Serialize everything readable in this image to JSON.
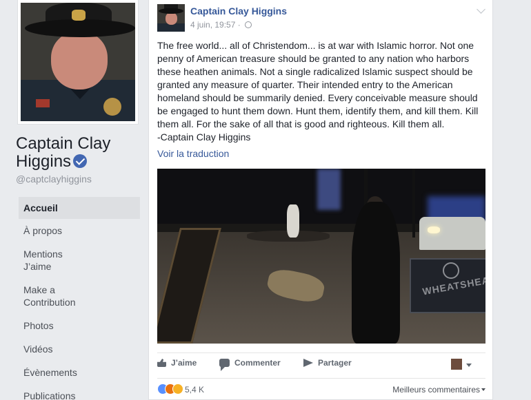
{
  "profile": {
    "name": "Captain Clay Higgins",
    "handle": "@captclayhiggins"
  },
  "nav": {
    "items": [
      {
        "label": "Accueil",
        "active": true
      },
      {
        "label": "À propos"
      },
      {
        "label": "Mentions J’aime"
      },
      {
        "label": "Make a Contribution"
      },
      {
        "label": "Photos"
      },
      {
        "label": "Vidéos"
      },
      {
        "label": "Évènements"
      },
      {
        "label": "Publications"
      }
    ]
  },
  "post": {
    "author": "Captain Clay Higgins",
    "timestamp": "4 juin, 19:57 · ",
    "text": "The free world... all of Christendom... is at war with Islamic horror. Not one penny of American treasure should be granted to any nation who harbors these heathen animals. Not a single radicalized Islamic suspect should be granted any measure of quarter. Their intended entry to the American homeland should be summarily denied. Every conceivable measure should be engaged to hunt them down. Hunt them, identify them, and kill them. Kill them all. For the sake of all that is good and righteous. Kill them all.\n-Captain Clay Higgins",
    "translate_label": "Voir la traduction",
    "photo_sign_text": "WHEATSHEA"
  },
  "actions": {
    "like": "J’aime",
    "comment": "Commenter",
    "share": "Partager"
  },
  "reactions": {
    "count": "5,4 K",
    "sort_label": "Meilleurs commentaires"
  },
  "colors": {
    "link": "#365899",
    "background": "#e9ebee",
    "verified": "#4267b2"
  }
}
